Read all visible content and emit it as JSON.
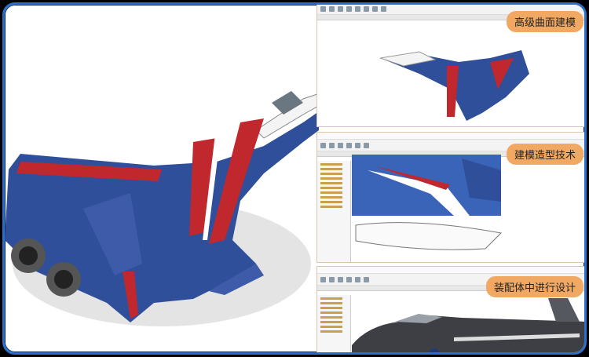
{
  "panels": [
    {
      "label": "高级曲面建模"
    },
    {
      "label": "建模造型技术"
    },
    {
      "label": "装配体中进行设计"
    }
  ],
  "colors": {
    "frame": "#2a6fc9",
    "label_bg": "#f0a863",
    "jet_blue": "#2f4f9a",
    "jet_red": "#c0282d"
  }
}
